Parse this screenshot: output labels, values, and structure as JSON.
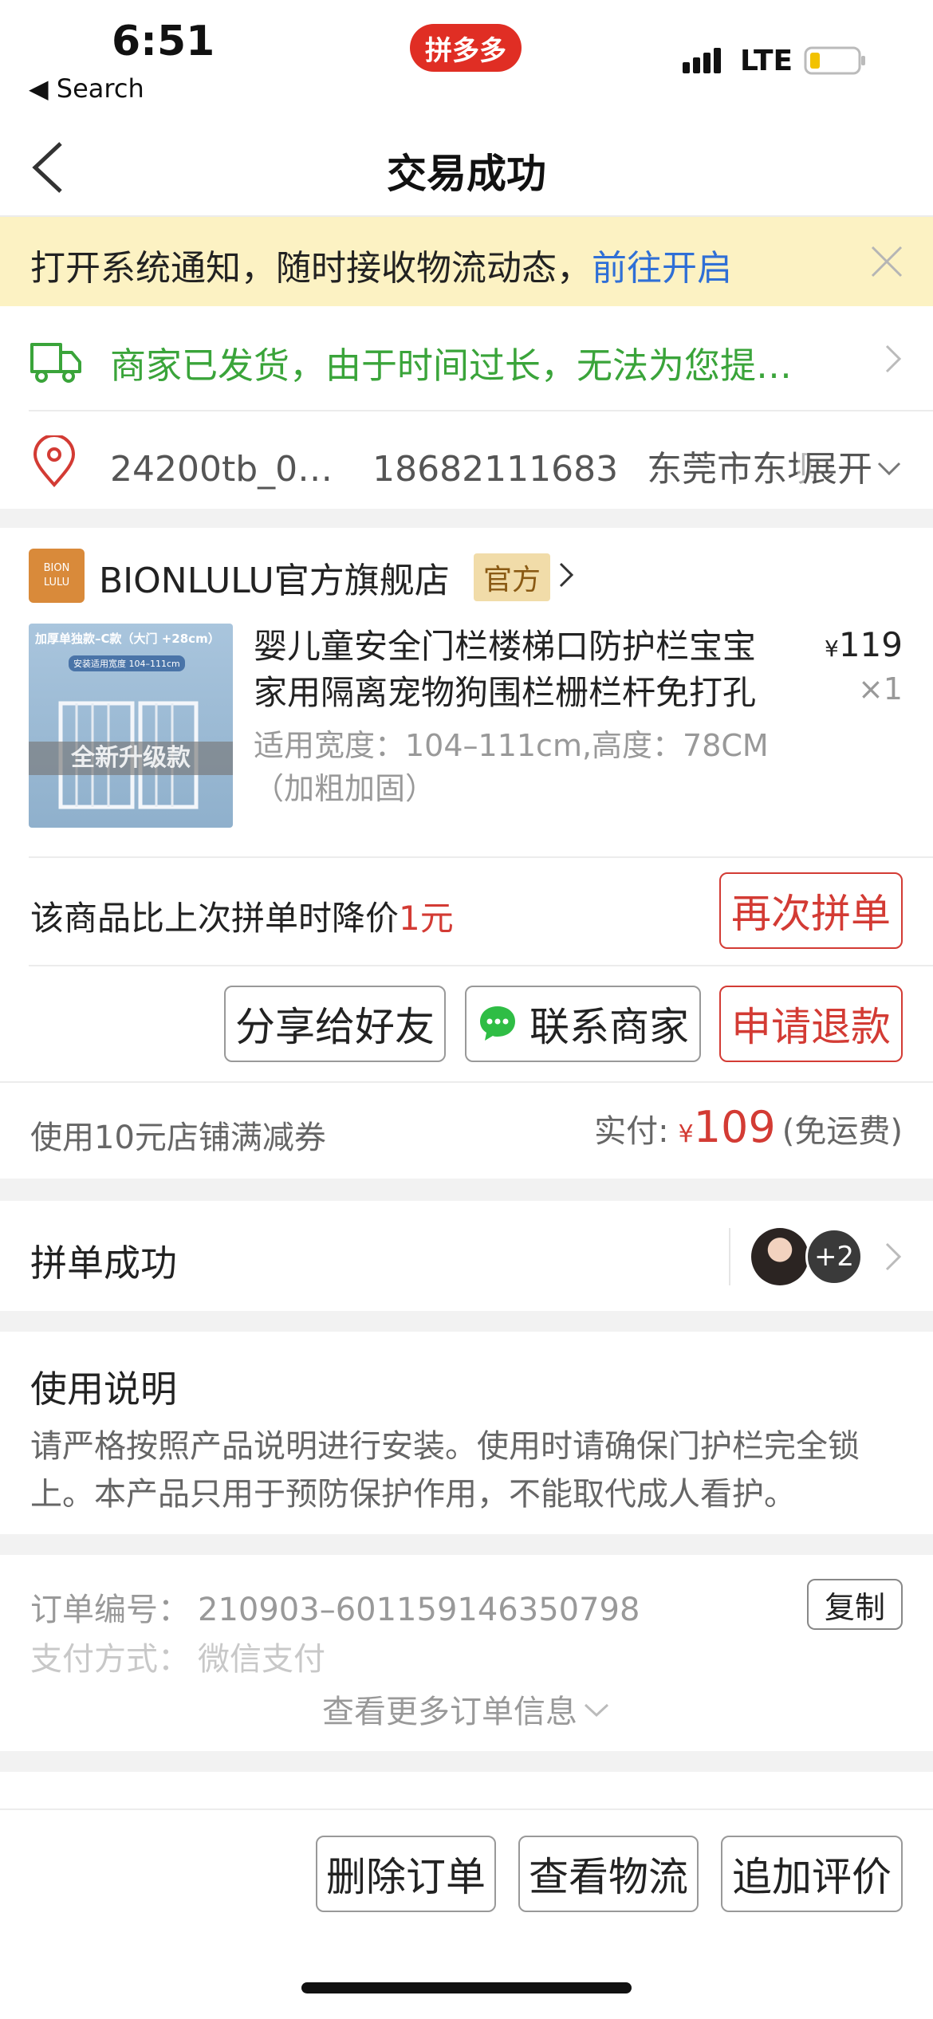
{
  "status_bar": {
    "time": "6:51",
    "back_app": "◀ Search",
    "center_logo_text": "拼多多",
    "network": "LTE"
  },
  "nav": {
    "title": "交易成功"
  },
  "notify_banner": {
    "text": "打开系统通知，随时接收物流动态，",
    "link": "前往开启"
  },
  "shipping": {
    "text": "商家已发货，由于时间过长，无法为您提…"
  },
  "address": {
    "name": "24200tb_0…",
    "phone": "18682111683",
    "location": "东莞市东坝",
    "expand": "展开"
  },
  "store": {
    "logo_line1": "BION",
    "logo_line2": "LULU",
    "name": "BIONLULU官方旗舰店",
    "badge": "官方"
  },
  "product": {
    "thumb_top": "加厚单独款–C款（大门 +28cm）",
    "thumb_sub": "安装适用宽度 104–111cm",
    "thumb_banner": "全新升级款",
    "title_line1": "婴儿童安全门栏楼梯口防护栏宝宝",
    "title_line2": "家用隔离宠物狗围栏栅栏杆免打孔",
    "spec_line1": "适用宽度：104–111cm,高度：78CM",
    "spec_line2": "（加粗加固）",
    "currency": "¥",
    "price": "119",
    "quantity": "×1"
  },
  "price_drop": {
    "text": "该商品比上次拼单时降价",
    "amount": "1元",
    "button": "再次拼单"
  },
  "actions": {
    "share": "分享给好友",
    "contact": "联系商家",
    "refund": "申请退款"
  },
  "payment": {
    "coupon": "使用10元店铺满减券",
    "paid_label": "实付:",
    "currency": "¥",
    "amount": "109",
    "shipping_note": "(免运费)"
  },
  "group": {
    "label": "拼单成功",
    "extra": "+2"
  },
  "instructions": {
    "title": "使用说明",
    "body": "请严格按照产品说明进行安装。使用时请确保门护栏完全锁上。本产品只用于预防保护作用，不能取代成人看护。"
  },
  "order_info": {
    "number_label": "订单编号：",
    "number": "210903–601159146350798",
    "copy": "复制",
    "pay_label": "支付方式：",
    "pay_method": "微信支付",
    "more": "查看更多订单信息"
  },
  "bottom_bar": {
    "delete": "删除订单",
    "logistics": "查看物流",
    "review": "追加评价"
  },
  "colors": {
    "brand_red": "#d33b34",
    "green": "#3aa43a",
    "link_blue": "#2f6fd6",
    "banner_yellow": "#fcf2c3"
  }
}
